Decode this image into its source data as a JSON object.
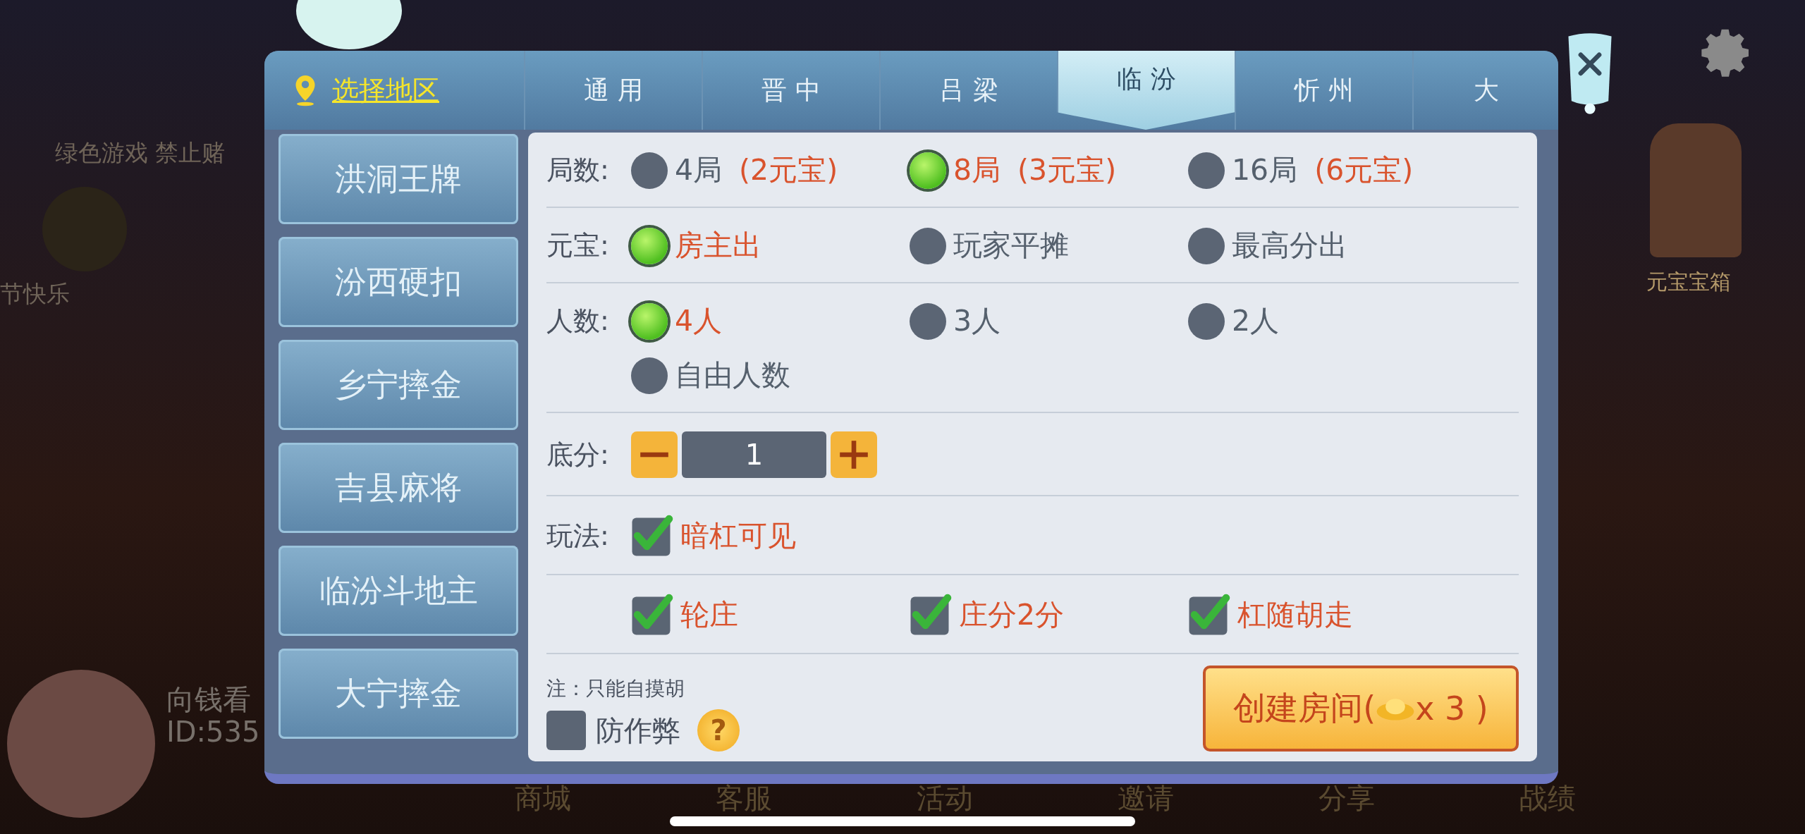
{
  "background": {
    "notice": "绿色游戏 禁止赌",
    "greeting": "节快乐",
    "player": {
      "name": "向钱看",
      "id": "ID:535"
    },
    "treasure_label": "元宝宝箱",
    "nav": [
      "商城",
      "客服",
      "活动",
      "邀请",
      "分享",
      "战绩"
    ]
  },
  "dialog": {
    "region_link": "选择地区",
    "tabs": [
      {
        "label": "通 用",
        "selected": false
      },
      {
        "label": "晋 中",
        "selected": false
      },
      {
        "label": "吕 梁",
        "selected": false
      },
      {
        "label": "临 汾",
        "selected": true
      },
      {
        "label": "忻 州",
        "selected": false
      },
      {
        "label": "大",
        "selected": false
      }
    ],
    "games": [
      "洪洞王牌",
      "汾西硬扣",
      "乡宁摔金",
      "吉县麻将",
      "临汾斗地主",
      "大宁摔金"
    ],
    "options": [
      {
        "label": "局数:",
        "kind": "radio",
        "choices": [
          {
            "text": "4局",
            "note": "(2元宝)",
            "selected": false
          },
          {
            "text": "8局",
            "note": "(3元宝)",
            "selected": true
          },
          {
            "text": "16局",
            "note": "(6元宝)",
            "selected": false
          }
        ]
      },
      {
        "label": "元宝:",
        "kind": "radio",
        "choices": [
          {
            "text": "房主出",
            "selected": true
          },
          {
            "text": "玩家平摊",
            "selected": false
          },
          {
            "text": "最高分出",
            "selected": false
          }
        ]
      },
      {
        "label": "人数:",
        "kind": "radio",
        "choices": [
          {
            "text": "4人",
            "selected": true
          },
          {
            "text": "3人",
            "selected": false
          },
          {
            "text": "2人",
            "selected": false
          },
          {
            "text": "自由人数",
            "selected": false
          }
        ]
      },
      {
        "label": "底分:",
        "kind": "stepper",
        "value": "1"
      },
      {
        "label": "玩法:",
        "kind": "checkbox",
        "choices": [
          {
            "text": "暗杠可见",
            "checked": true
          }
        ]
      },
      {
        "kind": "checkbox",
        "choices": [
          {
            "text": "轮庄",
            "checked": true
          },
          {
            "text": "庄分2分",
            "checked": true
          },
          {
            "text": "杠随胡走",
            "checked": true
          }
        ]
      }
    ],
    "note": "注：只能自摸胡",
    "anti_cheat": {
      "label": "防作弊",
      "checked": false
    },
    "help": "?",
    "create_button": {
      "label": "创建房间(",
      "count": "x 3 )"
    }
  }
}
